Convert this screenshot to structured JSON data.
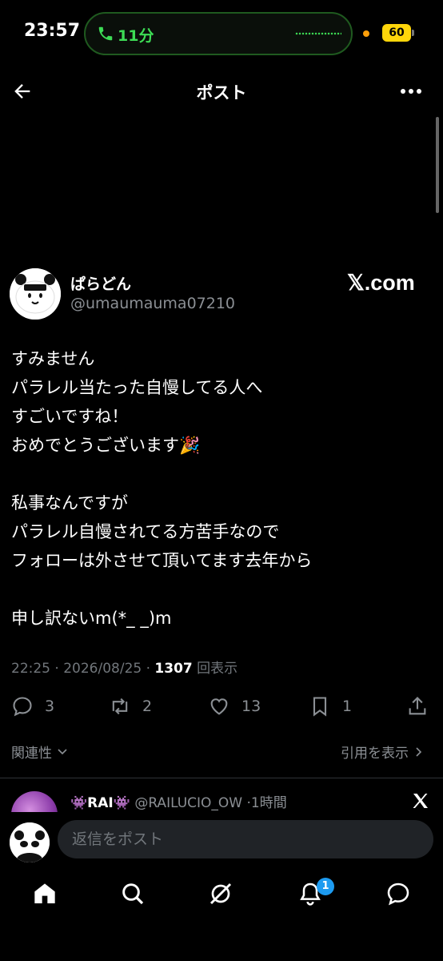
{
  "status_bar": {
    "time": "23:57",
    "call_duration": "11分",
    "battery": "60"
  },
  "header": {
    "title": "ポスト"
  },
  "tweet_image": {
    "display_name": "ぱらどん",
    "handle": "@umaumauma07210",
    "watermark": "𝕏.com",
    "lines": [
      "すみません",
      "パラレル当たった自慢してる人へ",
      "すごいですね！",
      "おめでとうございます🎉",
      "",
      "私事なんですが",
      "パラレル自慢されてる方苦手なので",
      "フォローは外させて頂いてます去年から",
      "",
      "申し訳ないm(*_ _)m"
    ]
  },
  "meta": {
    "time": "22:25",
    "date": "2026/08/25",
    "views": "1307",
    "views_label": "回表示"
  },
  "actions": {
    "replies": "3",
    "reposts": "2",
    "likes": "13",
    "bookmarks": "1"
  },
  "sort": {
    "relevance": "関連性",
    "quotes": "引用を表示"
  },
  "reply_preview": {
    "name": "👾RAI👾",
    "handle": "@RAILUCIO_OW",
    "time": "1時間"
  },
  "reply_bar": {
    "placeholder": "返信をポスト"
  },
  "bottom_nav": {
    "notification_badge": "1"
  },
  "colors": {
    "background": "#000000",
    "accent": "#1d9bf0",
    "call_green": "#3ddc55",
    "battery_yellow": "#ffd60a"
  }
}
